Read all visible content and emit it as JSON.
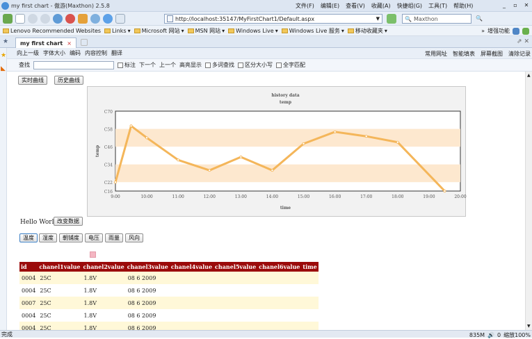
{
  "window": {
    "title": "my first chart - 傲游(Maxthon) 2.5.8",
    "menus": [
      "文件(F)",
      "编辑(E)",
      "查看(V)",
      "收藏(A)",
      "快捷组(G)",
      "工具(T)",
      "帮助(H)"
    ]
  },
  "toolbar": {
    "address": "http://localhost:35147/MyFirstChart1/Default.aspx",
    "search_placeholder": "Maxthon"
  },
  "favorites": {
    "items": [
      "Lenovo Recommended Websites",
      "Links",
      "Microsoft 网站",
      "MSN 网站",
      "Windows Live",
      "Windows Live 服务",
      "移动收藏夹"
    ],
    "right_label": "增强功能"
  },
  "tab": {
    "label": "my first chart",
    "close": "×"
  },
  "pagebar1": {
    "items": [
      "向上一级",
      "字体大小",
      "编码",
      "内容控制",
      "翻译"
    ],
    "right": [
      "常用网址",
      "智能填表",
      "屏幕截图",
      "清除记录"
    ]
  },
  "pagebar2": {
    "find_label": "查找",
    "checks": [
      "标注",
      "下一个",
      "上一个",
      "高亮显示",
      "多词查找",
      "区分大小写",
      "全字匹配"
    ]
  },
  "buttons": {
    "realtime": "实时曲线",
    "history": "历史曲线",
    "change_data": "改变数据",
    "hello": "Hello World!",
    "sensors": [
      "温度",
      "湿度",
      "朝铺度",
      "电压",
      "雨量",
      "风向"
    ]
  },
  "chart_data": {
    "type": "line",
    "title": "history data",
    "subtitle": "temp",
    "xlabel": "time",
    "ylabel": "temp",
    "categories": [
      "9:00",
      "10:00",
      "11:00",
      "12:00",
      "13:00",
      "14:00",
      "15:00",
      "16:00",
      "17:00",
      "18:00",
      "19:00",
      "20:00"
    ],
    "x": [
      0,
      0.5,
      1,
      2,
      3,
      4,
      5,
      6,
      7,
      8,
      9,
      10.5
    ],
    "values": [
      22,
      60,
      52,
      37,
      30,
      39,
      30,
      48,
      56,
      53,
      49,
      16
    ],
    "ylim": [
      16,
      70
    ],
    "yticks": [
      16,
      22,
      34,
      46,
      58,
      70
    ],
    "ytick_labels": [
      "C16",
      "C22",
      "C34",
      "C46",
      "C58",
      "C70"
    ],
    "bands": [
      [
        22,
        34
      ],
      [
        46,
        58
      ]
    ],
    "line_color": "#f4b65a",
    "band_color": "#fde8cf"
  },
  "table": {
    "headers": [
      "id",
      "chanel1value",
      "chanel2value",
      "chanel3value",
      "chanel4value",
      "chanel5value",
      "chanel6value",
      "time"
    ],
    "rows": [
      [
        "0004",
        "25C",
        "1.8V",
        "08 6 2009"
      ],
      [
        "0004",
        "25C",
        "1.8V",
        "08 6 2009"
      ],
      [
        "0007",
        "25C",
        "1.8V",
        "08 6 2009"
      ],
      [
        "0004",
        "25C",
        "1.8V",
        "08 6 2009"
      ],
      [
        "0004",
        "25C",
        "1.8V",
        "08 6 2009"
      ]
    ]
  },
  "status": {
    "left": "完成",
    "memory": "835M",
    "count": "0",
    "zoom": "缩放100%"
  }
}
